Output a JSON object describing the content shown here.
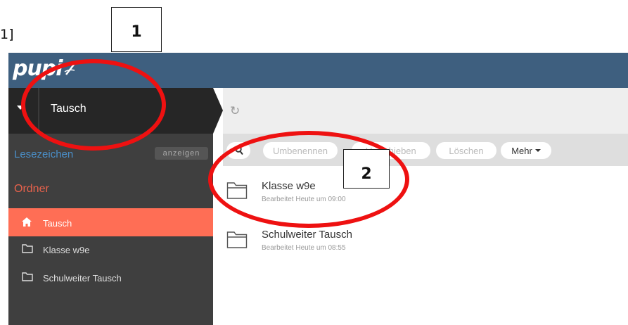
{
  "annotations": {
    "label_fragment": "1]",
    "label_1": "1",
    "label_2": "2"
  },
  "app": {
    "logo_text": "pupi"
  },
  "breadcrumb": {
    "title": "Tausch"
  },
  "sidebar": {
    "bookmarks_label": "Lesezeichen",
    "bookmarks_show": "anzeigen",
    "folders_label": "Ordner",
    "items": [
      {
        "label": "Tausch",
        "icon": "home-icon",
        "active": true
      },
      {
        "label": "Klasse w9e",
        "icon": "folder-icon",
        "active": false
      },
      {
        "label": "Schulweiter Tausch",
        "icon": "folder-icon",
        "active": false
      }
    ]
  },
  "toolbar": {
    "rename": "Umbenennen",
    "move": "Verschieben",
    "delete": "Löschen",
    "more": "Mehr"
  },
  "files": [
    {
      "name": "Klasse w9e",
      "meta": "Bearbeitet Heute um 09:00"
    },
    {
      "name": "Schulweiter Tausch",
      "meta": "Bearbeitet Heute um 08:55"
    }
  ],
  "colors": {
    "header": "#3e5f7f",
    "breadcrumb_dark": "#262626",
    "sidebar": "#3f3f3f",
    "active_item": "#ff6e55",
    "bookmarks_text": "#4a8fc9",
    "folders_text": "#e8624c",
    "annotation_red": "#ee1111"
  }
}
